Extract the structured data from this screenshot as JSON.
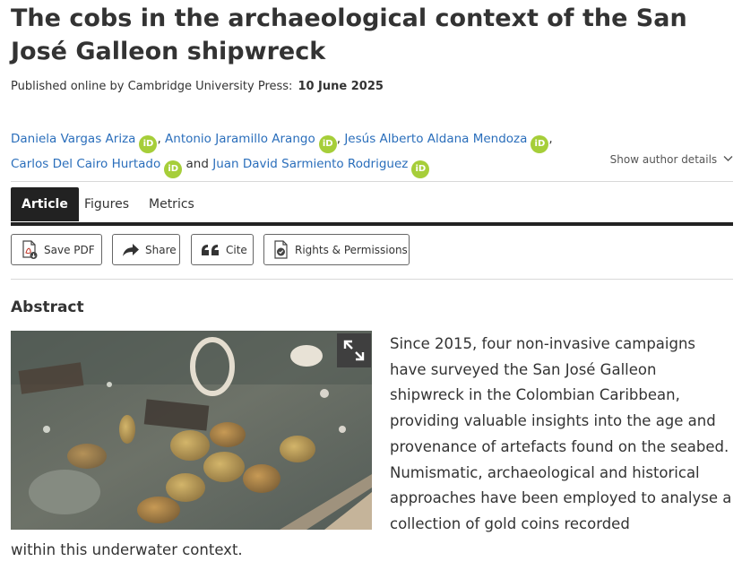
{
  "article": {
    "title": "The cobs in the archaeological context of the San José Galleon shipwreck",
    "published_label": "Published online by Cambridge University Press:",
    "published_date": "10 June 2025"
  },
  "authors": {
    "list": [
      "Daniela Vargas Ariza",
      "Antonio Jaramillo Arango",
      "Jesús Alberto Aldana Mendoza",
      "Carlos Del Cairo Hurtado",
      "Juan David Sarmiento Rodriguez"
    ],
    "orcid_label": "iD",
    "comma": ",",
    "and_word": "and",
    "show_details": "Show author details"
  },
  "tabs": [
    "Article",
    "Figures",
    "Metrics"
  ],
  "actions": {
    "save_pdf": "Save PDF",
    "share": "Share",
    "cite": "Cite",
    "rights": "Rights & Permissions"
  },
  "abstract": {
    "heading": "Abstract",
    "body": "Since 2015, four non-invasive campaigns have surveyed the San José Galleon shipwreck in the Colombian Caribbean, providing valuable insights into the age and provenance of artefacts found on the seabed. Numismatic, archaeological and historical approaches have been employed to analyse a collection of gold coins recorded",
    "tail": "within this underwater context."
  },
  "icons": {
    "orcid": "orcid-icon",
    "chevron": "chevron-down-icon",
    "pdf": "pdf-icon",
    "share": "share-arrow-icon",
    "cite": "quote-icon",
    "rights": "rights-document-icon",
    "expand": "expand-icon"
  },
  "colors": {
    "link": "#2a6ebb",
    "orcid": "#a6ce39",
    "tab_active": "#222222"
  }
}
